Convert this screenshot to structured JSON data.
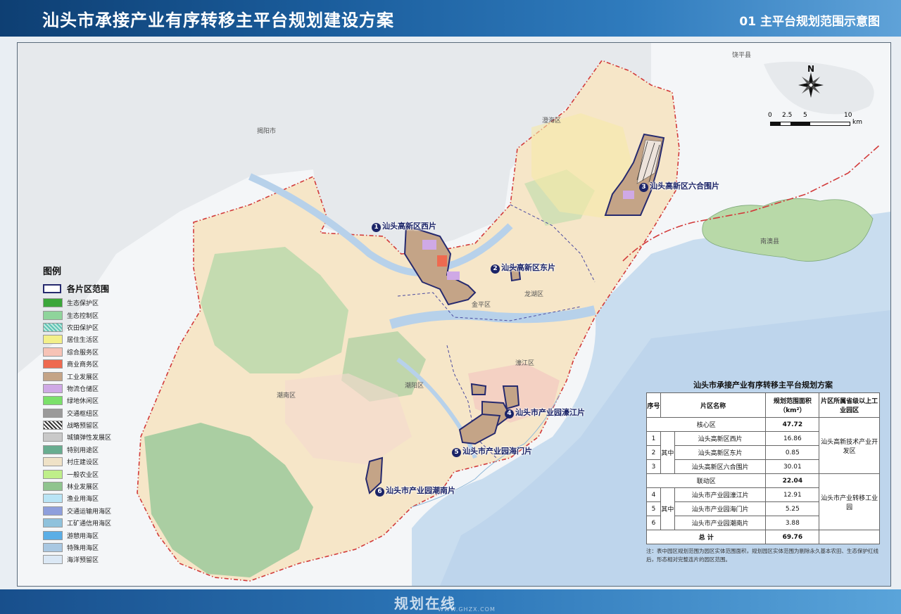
{
  "header": {
    "title": "汕头市承接产业有序转移主平台规划建设方案",
    "subtitle": "01 主平台规划范围示意图"
  },
  "legend": {
    "title": "图例",
    "boundary_label": "各片区范围",
    "items": [
      {
        "label": "生态保护区",
        "color": "#3aa63a"
      },
      {
        "label": "生态控制区",
        "color": "#8fd49b"
      },
      {
        "label": "农田保护区",
        "color": "#5ec3b4"
      },
      {
        "label": "居住生活区",
        "color": "#f3f08a"
      },
      {
        "label": "综合服务区",
        "color": "#f7c3b6"
      },
      {
        "label": "商业商务区",
        "color": "#ee6a50"
      },
      {
        "label": "工业发展区",
        "color": "#c4a487"
      },
      {
        "label": "物流仓储区",
        "color": "#cfa9e6"
      },
      {
        "label": "绿地休闲区",
        "color": "#7be06a"
      },
      {
        "label": "交通枢纽区",
        "color": "#9a9a9a"
      },
      {
        "label": "战略预留区",
        "color": "#555555"
      },
      {
        "label": "城镇弹性发展区",
        "color": "#c9c9c9"
      },
      {
        "label": "特别用途区",
        "color": "#68ad90"
      },
      {
        "label": "村庄建设区",
        "color": "#efe2c7"
      },
      {
        "label": "一般农业区",
        "color": "#bfef8a"
      },
      {
        "label": "林业发展区",
        "color": "#8fc48f"
      },
      {
        "label": "渔业用海区",
        "color": "#b9e4f5"
      },
      {
        "label": "交通运输用海区",
        "color": "#8e9fdc"
      },
      {
        "label": "工矿通信用海区",
        "color": "#8fc2dc"
      },
      {
        "label": "游憩用海区",
        "color": "#5aaee6"
      },
      {
        "label": "特殊用海区",
        "color": "#a9c8e2"
      },
      {
        "label": "海洋预留区",
        "color": "#dbe8f5"
      }
    ]
  },
  "sites": [
    {
      "num": "1",
      "name": "汕头高新区西片"
    },
    {
      "num": "2",
      "name": "汕头高新区东片"
    },
    {
      "num": "3",
      "name": "汕头高新区六合围片"
    },
    {
      "num": "4",
      "name": "汕头市产业园濠江片"
    },
    {
      "num": "5",
      "name": "汕头市产业园海门片"
    },
    {
      "num": "6",
      "name": "汕头市产业园潮南片"
    }
  ],
  "districts": [
    "澄海区",
    "龙湖区",
    "金平区",
    "濠江区",
    "潮阳区",
    "潮南区",
    "南澳县",
    "揭阳市",
    "饶平县"
  ],
  "compass": {
    "label": "N"
  },
  "scale": {
    "ticks": [
      "0",
      "2.5",
      "5",
      "10"
    ],
    "unit": "km"
  },
  "table": {
    "title": "汕头市承接产业有序转移主平台规划方案",
    "headers": [
      "序号",
      "片区名称",
      "规划范围面积（km²）",
      "片区所属省级以上工业园区"
    ],
    "core": {
      "label": "核心区",
      "area": "47.72"
    },
    "core_rows": [
      {
        "no": "1",
        "name": "汕头高新区西片",
        "area": "16.86"
      },
      {
        "no": "2",
        "name": "汕头高新区东片",
        "area": "0.85"
      },
      {
        "no": "3",
        "name": "汕头高新区六合围片",
        "area": "30.01"
      }
    ],
    "core_park": "汕头高新技术产业开发区",
    "linked": {
      "label": "联动区",
      "area": "22.04"
    },
    "linked_rows": [
      {
        "no": "4",
        "name": "汕头市产业园濠江片",
        "area": "12.91"
      },
      {
        "no": "5",
        "name": "汕头市产业园海门片",
        "area": "5.25"
      },
      {
        "no": "6",
        "name": "汕头市产业园潮南片",
        "area": "3.88"
      }
    ],
    "linked_park": "汕头市产业转移工业园",
    "qizhong": "其中",
    "total": {
      "label": "总 计",
      "area": "69.76"
    },
    "note": "注：表中园区规划范围为园区实体范围面积，规划园区实体范围为剔除永久基本农田、生态保护红线后，形态相对完整连片的园区范围。"
  },
  "watermark": {
    "text": "规划在线",
    "url": "WWW.GHZX.COM"
  }
}
